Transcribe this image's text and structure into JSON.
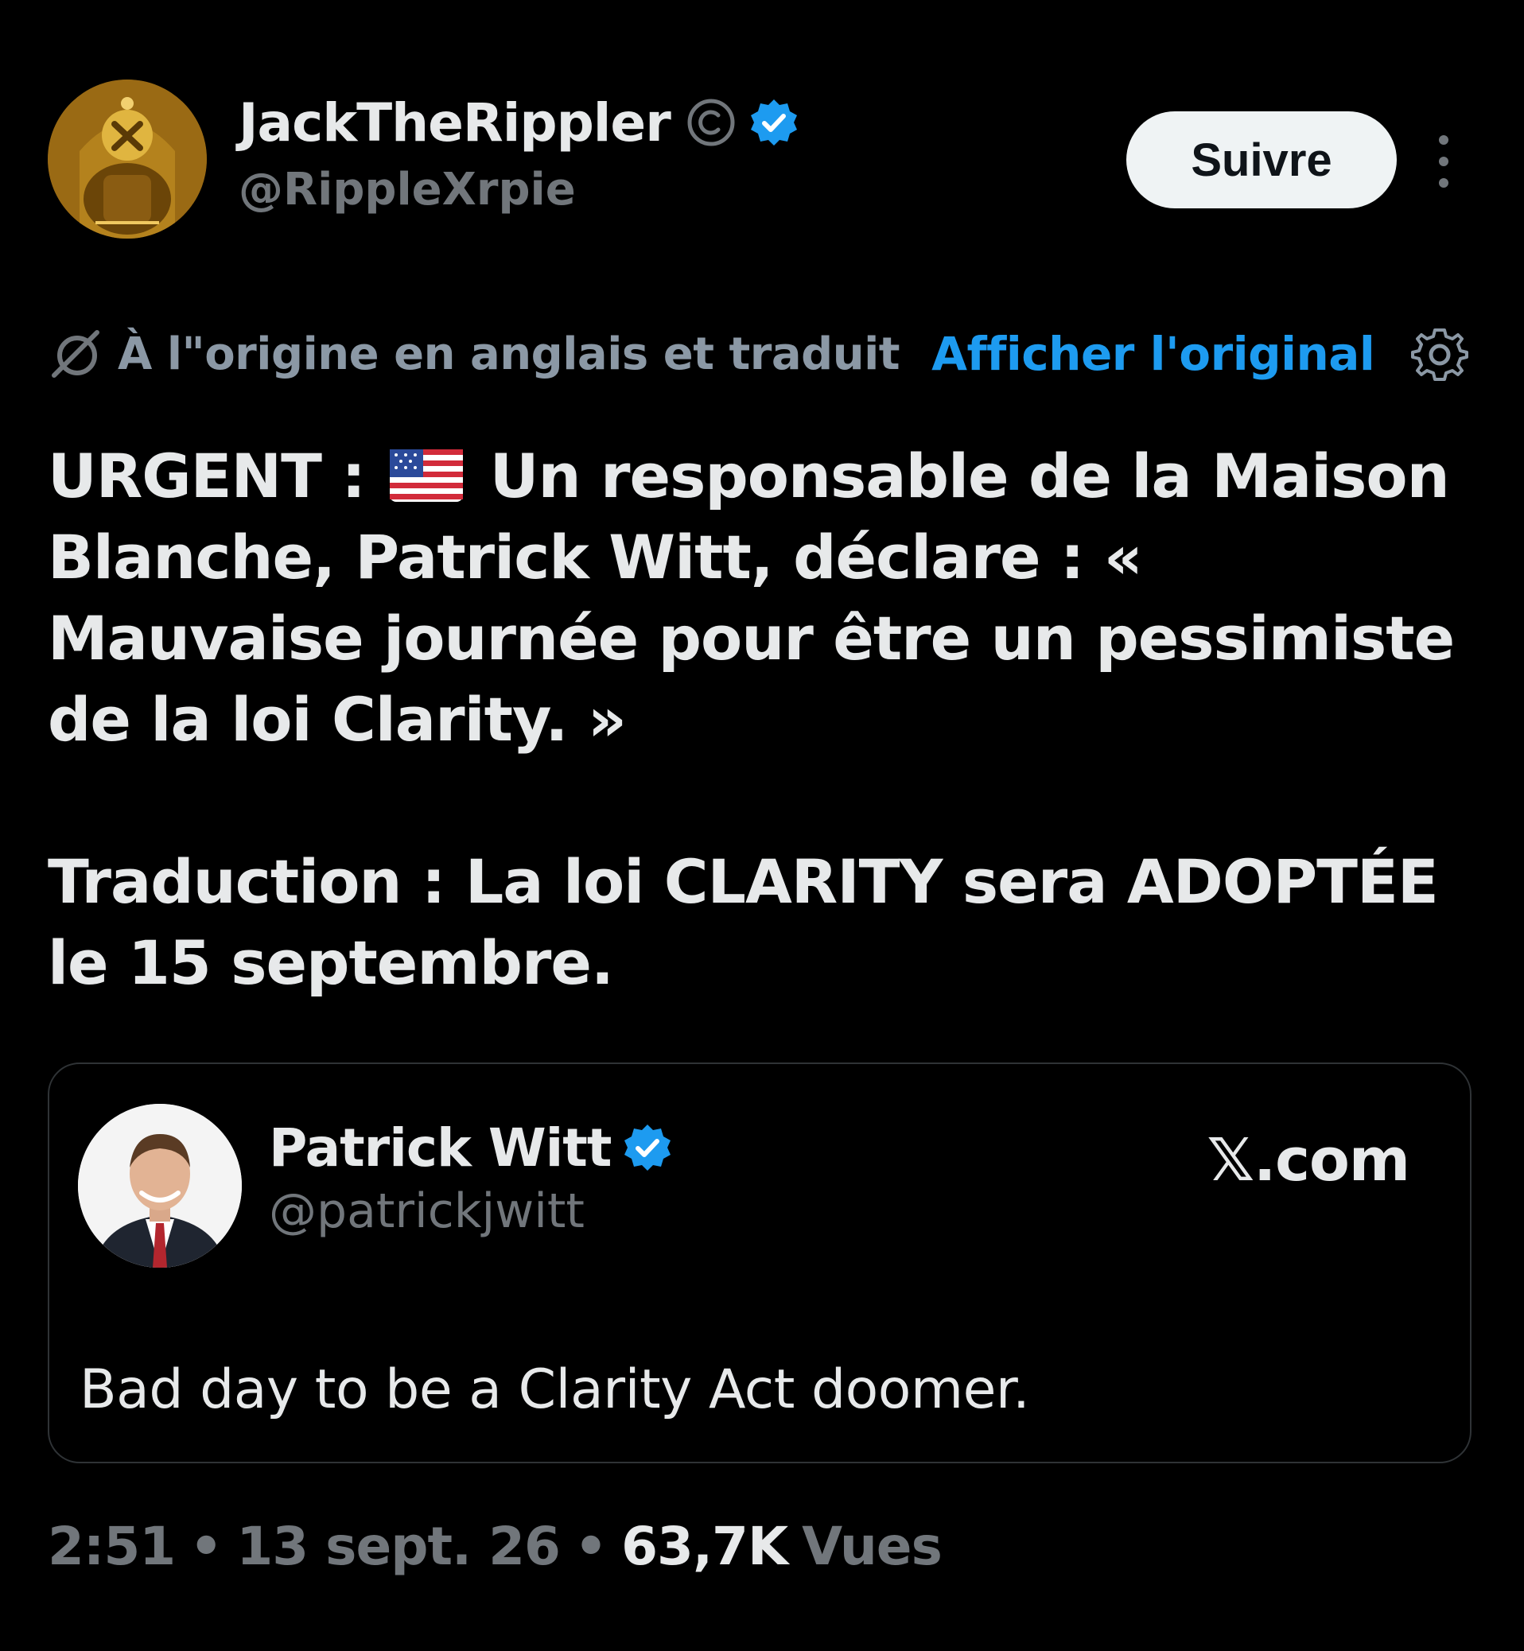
{
  "colors": {
    "background": "#000000",
    "text_primary": "#e7e9ea",
    "text_secondary": "#71767b",
    "accent_link": "#1d9bf0",
    "verified_badge": "#1d9bf0",
    "card_border": "#2f3336",
    "follow_button_bg": "#eff3f4"
  },
  "author": {
    "display_name": "JackTheRippler",
    "handle": "@RippleXrpie",
    "icons": [
      "copyright-icon",
      "verified-icon"
    ],
    "avatar": "gold-xrp-throne-avatar"
  },
  "header": {
    "follow_label": "Suivre",
    "more_icon": "more-vertical-icon"
  },
  "translation": {
    "notice": "À l\"origine en anglais et traduit",
    "show_original_label": "Afficher l'original",
    "translate_icon": "translate-slash-icon",
    "settings_icon": "gear-icon"
  },
  "tweet": {
    "line1_prefix": "URGENT :",
    "flag_icon": "us-flag-emoji",
    "paragraph1_rest": "Un responsable de la Maison Blanche, Patrick Witt, déclare : « Mauvaise journée pour être un pessimiste de la loi Clarity. »",
    "paragraph2": "Traduction : La loi CLARITY sera ADOPTÉE le 15 septembre."
  },
  "quote": {
    "display_name": "Patrick Witt",
    "handle": "@patrickjwitt",
    "domain": "𝕏.com",
    "text": "Bad day to be a Clarity Act doomer.",
    "avatar": "patrick-witt-portrait"
  },
  "meta": {
    "time": "2:51",
    "date": "13 sept. 26",
    "views_count": "63,7K",
    "views_label": "Vues",
    "separator": "•"
  }
}
